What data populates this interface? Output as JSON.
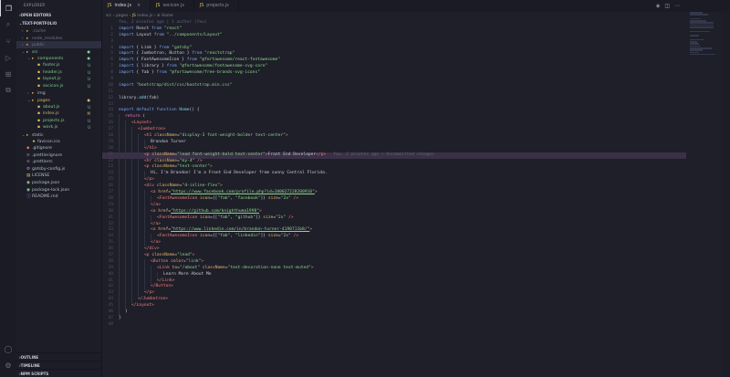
{
  "sidebar": {
    "title": "EXPLORER",
    "open_editors": "OPEN EDITORS",
    "project": "TEXT-PORTFOLIO",
    "tree": [
      {
        "label": ".cache",
        "depth": 1,
        "kind": "folder",
        "state": "dim",
        "open": false,
        "badge": ""
      },
      {
        "label": "node_modules",
        "depth": 1,
        "kind": "folder",
        "state": "dim",
        "open": false,
        "badge": ""
      },
      {
        "label": "public",
        "depth": 1,
        "kind": "folder",
        "state": "dim",
        "open": false,
        "badge": ""
      },
      {
        "label": "src",
        "depth": 1,
        "kind": "folder",
        "state": "u",
        "open": true,
        "badge": "●"
      },
      {
        "label": "components",
        "depth": 2,
        "kind": "folder",
        "state": "u",
        "open": true,
        "badge": "●"
      },
      {
        "label": "footer.js",
        "depth": 3,
        "kind": "js",
        "state": "u",
        "open": false,
        "badge": "U"
      },
      {
        "label": "header.js",
        "depth": 3,
        "kind": "js",
        "state": "u",
        "open": false,
        "badge": "U"
      },
      {
        "label": "layout.js",
        "depth": 3,
        "kind": "js",
        "state": "u",
        "open": false,
        "badge": "U"
      },
      {
        "label": "socicon.js",
        "depth": 3,
        "kind": "js",
        "state": "u",
        "open": false,
        "badge": "U"
      },
      {
        "label": "img",
        "depth": 2,
        "kind": "folder",
        "state": "",
        "open": false,
        "badge": ""
      },
      {
        "label": "pages",
        "depth": 2,
        "kind": "folder",
        "state": "m",
        "open": true,
        "badge": "●"
      },
      {
        "label": "about.js",
        "depth": 3,
        "kind": "js",
        "state": "u",
        "open": false,
        "badge": "U"
      },
      {
        "label": "index.js",
        "depth": 3,
        "kind": "js",
        "state": "m",
        "open": false,
        "badge": "M"
      },
      {
        "label": "projects.js",
        "depth": 3,
        "kind": "js",
        "state": "u",
        "open": false,
        "badge": "U"
      },
      {
        "label": "work.js",
        "depth": 3,
        "kind": "js",
        "state": "u",
        "open": false,
        "badge": "U"
      },
      {
        "label": "static",
        "depth": 1,
        "kind": "folder",
        "state": "",
        "open": true,
        "badge": ""
      },
      {
        "label": "favicon.ico",
        "depth": 2,
        "kind": "star",
        "state": "",
        "open": false,
        "badge": ""
      },
      {
        "label": ".gitignore",
        "depth": 1,
        "kind": "git",
        "state": "",
        "open": false,
        "badge": ""
      },
      {
        "label": ".prettierignore",
        "depth": 1,
        "kind": "cfg",
        "state": "",
        "open": false,
        "badge": ""
      },
      {
        "label": ".prettierrc",
        "depth": 1,
        "kind": "cfg",
        "state": "",
        "open": false,
        "badge": ""
      },
      {
        "label": "gatsby-config.js",
        "depth": 1,
        "kind": "gear",
        "state": "",
        "open": false,
        "badge": ""
      },
      {
        "label": "LICENSE",
        "depth": 1,
        "kind": "lic",
        "state": "",
        "open": false,
        "badge": ""
      },
      {
        "label": "package.json",
        "depth": 1,
        "kind": "pkg",
        "state": "",
        "open": false,
        "badge": ""
      },
      {
        "label": "package-lock.json",
        "depth": 1,
        "kind": "pkg",
        "state": "",
        "open": false,
        "badge": ""
      },
      {
        "label": "README.md",
        "depth": 1,
        "kind": "info",
        "state": "",
        "open": false,
        "badge": ""
      }
    ],
    "footer": [
      "OUTLINE",
      "TIMELINE",
      "NPM SCRIPTS"
    ]
  },
  "tabs": [
    {
      "label": "index.js",
      "active": true
    },
    {
      "label": "socicon.js",
      "active": false
    },
    {
      "label": "projects.js",
      "active": false
    }
  ],
  "breadcrumb": [
    "src",
    "pages",
    "index.js",
    "Home"
  ],
  "blame_top": "You, 2 minutes ago | 1 author (You)",
  "blame_inline": "You, 2 minutes ago • Uncommitted changes",
  "colors": {
    "accent_keyword": "#7aa7f5",
    "string": "#8fd48c",
    "tag": "#f07e7e",
    "attribute": "#e9b86d"
  }
}
